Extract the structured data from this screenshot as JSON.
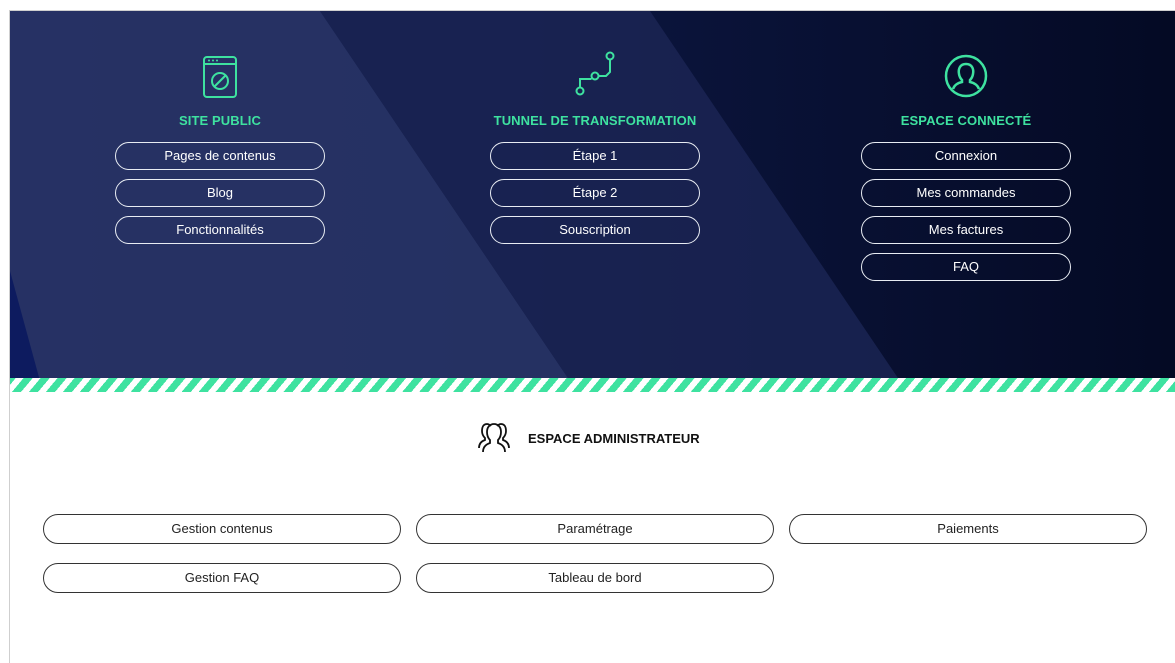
{
  "colors": {
    "accent": "#3ee2a0",
    "background_dark": "#0c1640",
    "pill_border": "#e8ecf3"
  },
  "sections": [
    {
      "icon": "browser-window-icon",
      "title": "SITE PUBLIC",
      "items": [
        "Pages de contenus",
        "Blog",
        "Fonctionnalités"
      ]
    },
    {
      "icon": "path-nodes-icon",
      "title": "TUNNEL DE TRANSFORMATION",
      "items": [
        "Étape 1",
        "Étape 2",
        "Souscription"
      ]
    },
    {
      "icon": "user-circle-icon",
      "title": "ESPACE CONNECTÉ",
      "items": [
        "Connexion",
        "Mes commandes",
        "Mes factures",
        "FAQ"
      ]
    }
  ],
  "admin": {
    "icon": "users-group-icon",
    "title": "ESPACE ADMINISTRATEUR",
    "items": [
      "Gestion contenus",
      "Paramétrage",
      "Paiements",
      "Gestion FAQ",
      "Tableau de bord"
    ]
  }
}
